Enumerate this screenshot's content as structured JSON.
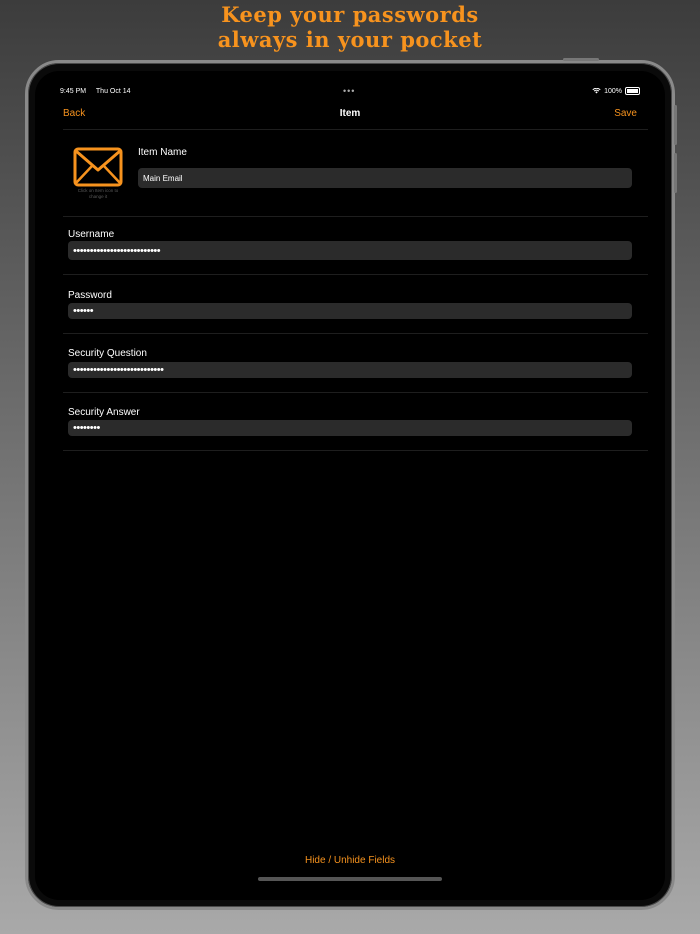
{
  "headline": {
    "line1": "Keep your passwords",
    "line2": "always in your pocket",
    "color": "#f7931e"
  },
  "status_bar": {
    "time": "9:45 PM",
    "date": "Thu Oct 14",
    "battery": "100%"
  },
  "nav": {
    "back_label": "Back",
    "title": "Item",
    "save_label": "Save"
  },
  "item": {
    "icon": "envelope-icon",
    "icon_caption": "Click on Item icon to change it",
    "name_label": "Item Name",
    "name_value": "Main Email"
  },
  "fields": {
    "username": {
      "label": "Username",
      "value": "••••••••••••••••••••••••••"
    },
    "password": {
      "label": "Password",
      "value": "••••••"
    },
    "security_question": {
      "label": "Security Question",
      "value": "•••••••••••••••••••••••••••"
    },
    "security_answer": {
      "label": "Security Answer",
      "value": "••••••••"
    }
  },
  "footer": {
    "toggle_label": "Hide / Unhide Fields"
  },
  "colors": {
    "accent": "#f7931e",
    "screen_bg": "#000000",
    "field_bg": "#2b2b2b"
  }
}
